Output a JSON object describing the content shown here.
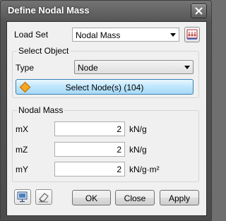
{
  "window": {
    "title": "Define Nodal Mass"
  },
  "load_set": {
    "label": "Load Set",
    "value": "Nodal Mass"
  },
  "select_object": {
    "title": "Select Object",
    "type_label": "Type",
    "type_value": "Node",
    "select_button": "Select Node(s) (104)"
  },
  "nodal_mass": {
    "title": "Nodal Mass",
    "fields": [
      {
        "label": "mX",
        "value": "2",
        "unit": "kN/g"
      },
      {
        "label": "mZ",
        "value": "2",
        "unit": "kN/g"
      },
      {
        "label": "mY",
        "value": "2",
        "unit": "kN/g·m²"
      }
    ]
  },
  "buttons": {
    "ok": "OK",
    "close": "Close",
    "apply": "Apply"
  },
  "icons": {
    "load_set_manager": "load-set-icon",
    "preview": "monitor-icon",
    "clear": "eraser-icon",
    "select": "diamond-icon"
  },
  "colors": {
    "accent": "#3c7fb1",
    "icon_red": "#c03030",
    "diamond": "#f5a623"
  }
}
